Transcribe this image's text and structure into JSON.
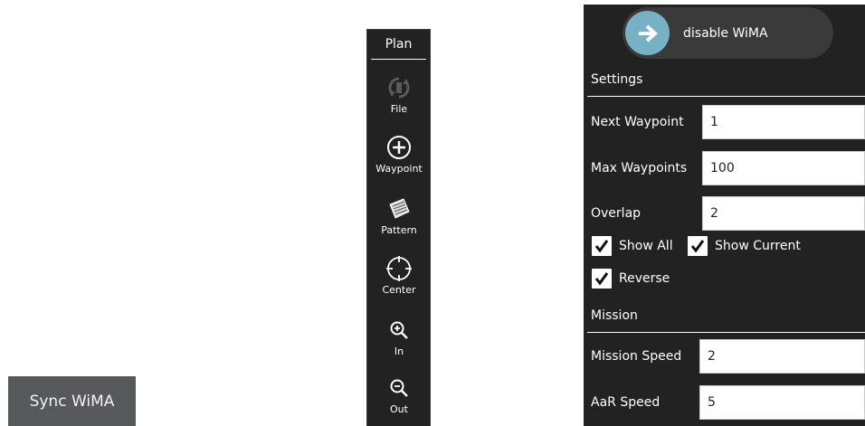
{
  "sync_button": {
    "label": "Sync WiMA"
  },
  "toolbar": {
    "title": "Plan",
    "tools": [
      {
        "label": "File",
        "icon": "sync-file-icon",
        "enabled": false
      },
      {
        "label": "Waypoint",
        "icon": "plus-circle-icon",
        "enabled": true
      },
      {
        "label": "Pattern",
        "icon": "pattern-icon",
        "enabled": true
      },
      {
        "label": "Center",
        "icon": "crosshair-icon",
        "enabled": true
      },
      {
        "label": "In",
        "icon": "zoom-in-icon",
        "enabled": true
      },
      {
        "label": "Out",
        "icon": "zoom-out-icon",
        "enabled": true
      }
    ]
  },
  "panel": {
    "toggle": {
      "label": "disable WiMA",
      "knob_color": "#76b1c6"
    },
    "settings": {
      "title": "Settings",
      "next_waypoint": {
        "label": "Next Waypoint",
        "value": "1"
      },
      "max_waypoints": {
        "label": "Max Waypoints",
        "value": "100"
      },
      "overlap": {
        "label": "Overlap",
        "value": "2"
      },
      "show_all": {
        "label": "Show All",
        "checked": true
      },
      "show_current": {
        "label": "Show Current",
        "checked": true
      },
      "reverse": {
        "label": "Reverse",
        "checked": true
      }
    },
    "mission": {
      "title": "Mission",
      "mission_speed": {
        "label": "Mission Speed",
        "value": "2"
      },
      "aar_speed": {
        "label": "AaR Speed",
        "value": "5"
      }
    }
  }
}
